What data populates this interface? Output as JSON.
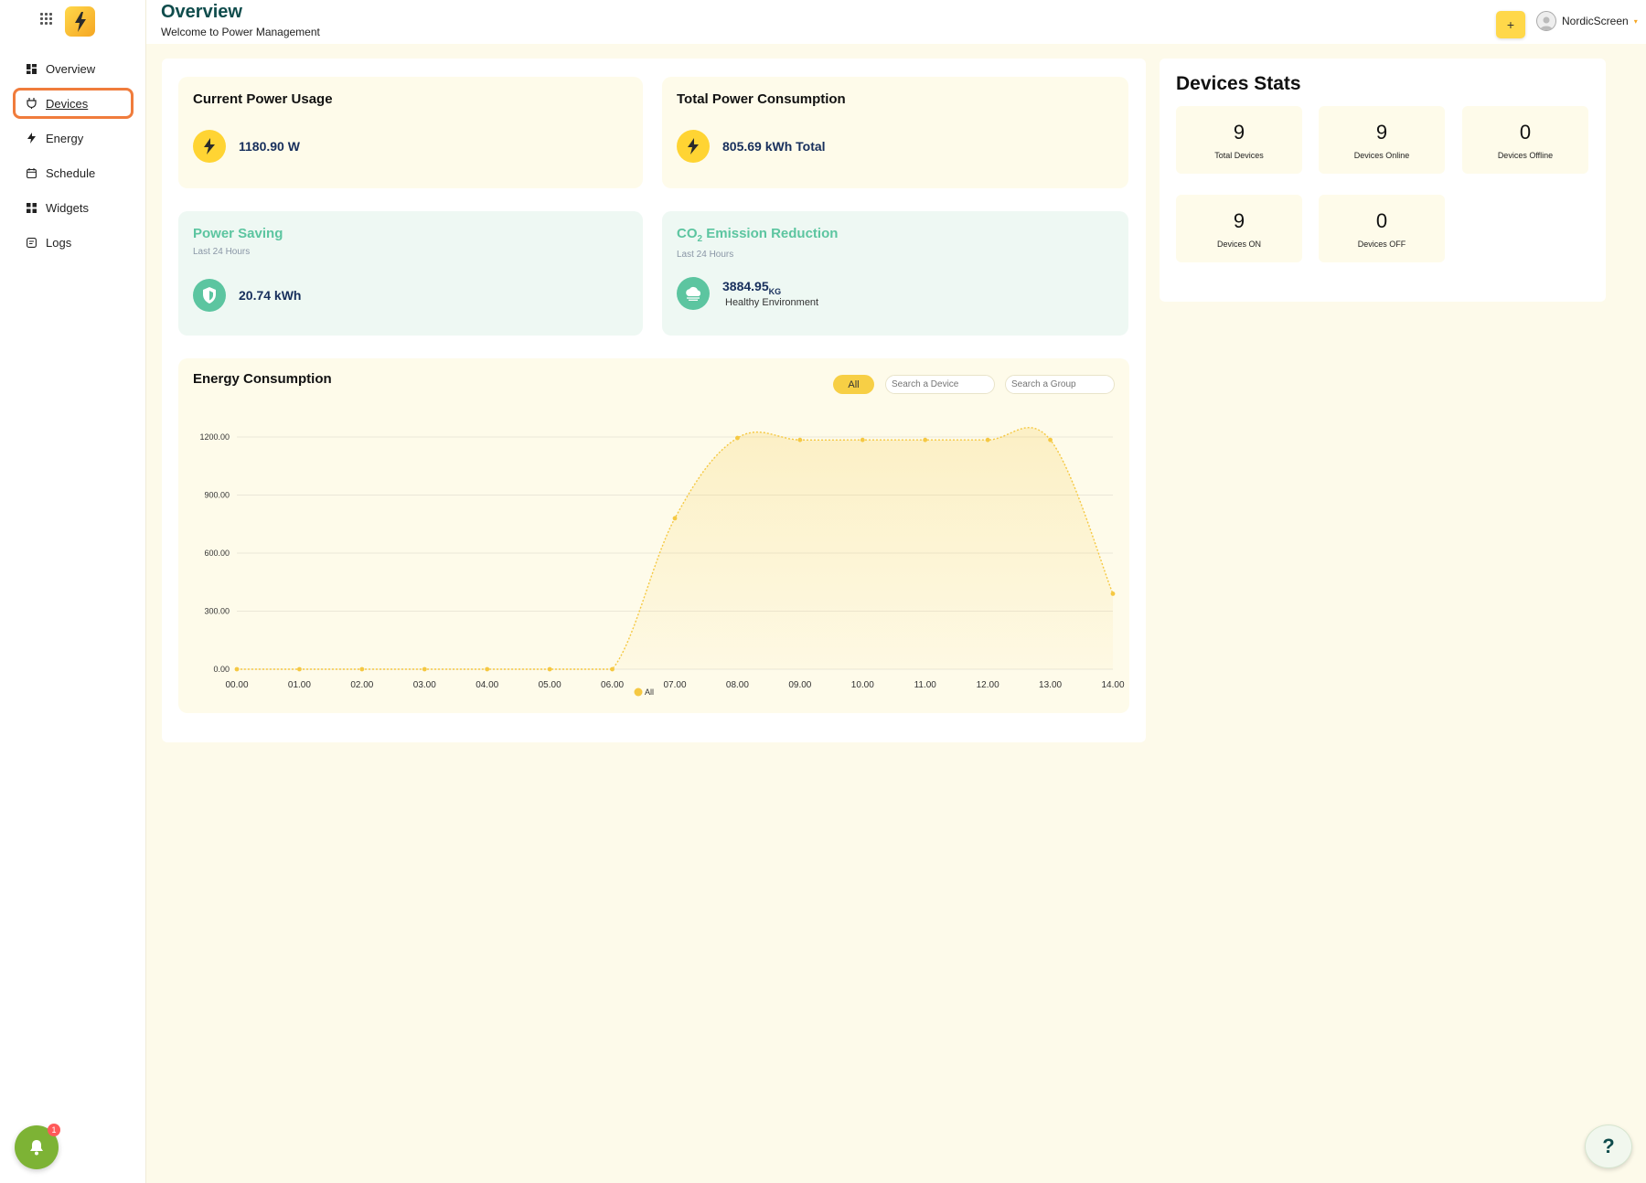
{
  "header": {
    "title": "Overview",
    "subtitle": "Welcome to Power Management",
    "add_label": "+",
    "username": "NordicScreen"
  },
  "sidebar": {
    "items": [
      {
        "label": "Overview",
        "icon": "dashboard-icon"
      },
      {
        "label": "Devices",
        "icon": "plug-icon",
        "active": true
      },
      {
        "label": "Energy",
        "icon": "bolt-icon"
      },
      {
        "label": "Schedule",
        "icon": "calendar-icon"
      },
      {
        "label": "Widgets",
        "icon": "widgets-icon"
      },
      {
        "label": "Logs",
        "icon": "logs-icon"
      }
    ],
    "notification_count": "1"
  },
  "cards": {
    "current_power": {
      "title": "Current Power Usage",
      "value": "1180.90 W"
    },
    "total_power": {
      "title": "Total Power Consumption",
      "value": "805.69 kWh Total"
    },
    "power_saving": {
      "title": "Power Saving",
      "period": "Last 24 Hours",
      "value": "20.74 kWh"
    },
    "co2": {
      "title_prefix": "CO",
      "title_sub": "2",
      "title_suffix": " Emission Reduction",
      "period": "Last 24 Hours",
      "value": "3884.95",
      "unit": "KG",
      "note": "Healthy Environment"
    }
  },
  "energy": {
    "title": "Energy Consumption",
    "filter_all": "All",
    "device_placeholder": "Search a Device",
    "group_placeholder": "Search a Group"
  },
  "chart_data": {
    "type": "area",
    "title": "Energy Consumption",
    "categories": [
      "00.00",
      "01.00",
      "02.00",
      "03.00",
      "04.00",
      "05.00",
      "06.00",
      "07.00",
      "08.00",
      "09.00",
      "10.00",
      "11.00",
      "12.00",
      "13.00",
      "14.00"
    ],
    "series": [
      {
        "name": "All",
        "values": [
          0,
          0,
          0,
          0,
          0,
          0,
          0,
          780,
          1195,
          1185,
          1185,
          1185,
          1185,
          1185,
          390
        ]
      }
    ],
    "yticks": [
      "0.00",
      "300.00",
      "600.00",
      "900.00",
      "1200.00"
    ],
    "ylim": [
      0,
      1200
    ],
    "grid": true,
    "legend": "bottom",
    "color": "#f5c842"
  },
  "stats": {
    "title": "Devices Stats",
    "tiles": [
      {
        "value": "9",
        "label": "Total Devices"
      },
      {
        "value": "9",
        "label": "Devices Online"
      },
      {
        "value": "0",
        "label": "Devices Offline"
      },
      {
        "value": "9",
        "label": "Devices ON"
      },
      {
        "value": "0",
        "label": "Devices OFF"
      }
    ]
  },
  "help_label": "?",
  "colors": {
    "accent": "#ffd433",
    "teal": "#5cc5a0",
    "active_border": "#f07c3c",
    "background": "#fdfaea"
  }
}
